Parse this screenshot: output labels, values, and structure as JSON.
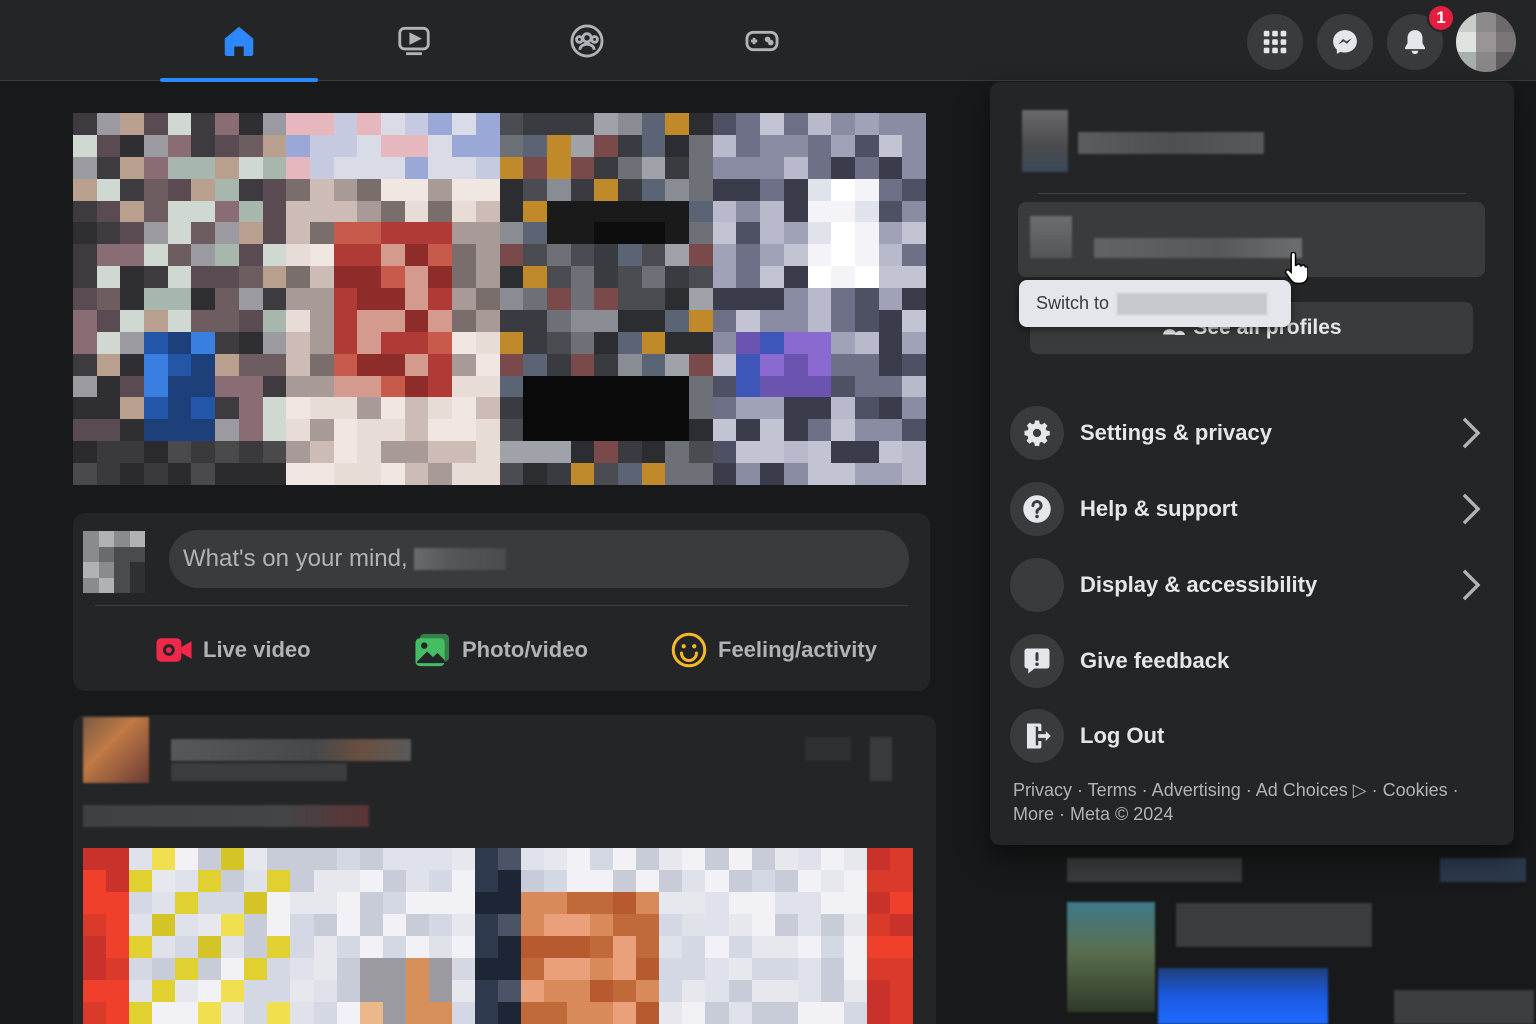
{
  "colors": {
    "accent": "#2d88ff",
    "background": "#18191a",
    "surface": "#242526",
    "badge": "#e41e3f"
  },
  "nav": {
    "tabs": [
      {
        "icon": "home-icon",
        "active": true
      },
      {
        "icon": "watch-icon",
        "active": false
      },
      {
        "icon": "groups-icon",
        "active": false
      },
      {
        "icon": "gaming-icon",
        "active": false
      }
    ]
  },
  "top_right": {
    "menu_icon": "grid-menu-icon",
    "messenger_icon": "messenger-icon",
    "notifications_icon": "bell-icon",
    "notification_count": "1"
  },
  "composer": {
    "placeholder": "What's on your mind, ",
    "actions": {
      "live": "Live video",
      "photo": "Photo/video",
      "feeling": "Feeling/activity"
    }
  },
  "account_menu": {
    "tooltip": "Switch to",
    "see_all": "See all profiles",
    "items": [
      {
        "label": "Settings & privacy",
        "icon": "gear-icon"
      },
      {
        "label": "Help & support",
        "icon": "question-icon"
      },
      {
        "label": "Display & accessibility",
        "icon": "moon-icon"
      },
      {
        "label": "Give feedback",
        "icon": "feedback-icon"
      },
      {
        "label": "Log Out",
        "icon": "logout-icon"
      }
    ],
    "footer": {
      "line1": "Privacy · Terms · Advertising · Ad Choices ▷ · Cookies ·",
      "line2": "More · Meta © 2024"
    }
  }
}
